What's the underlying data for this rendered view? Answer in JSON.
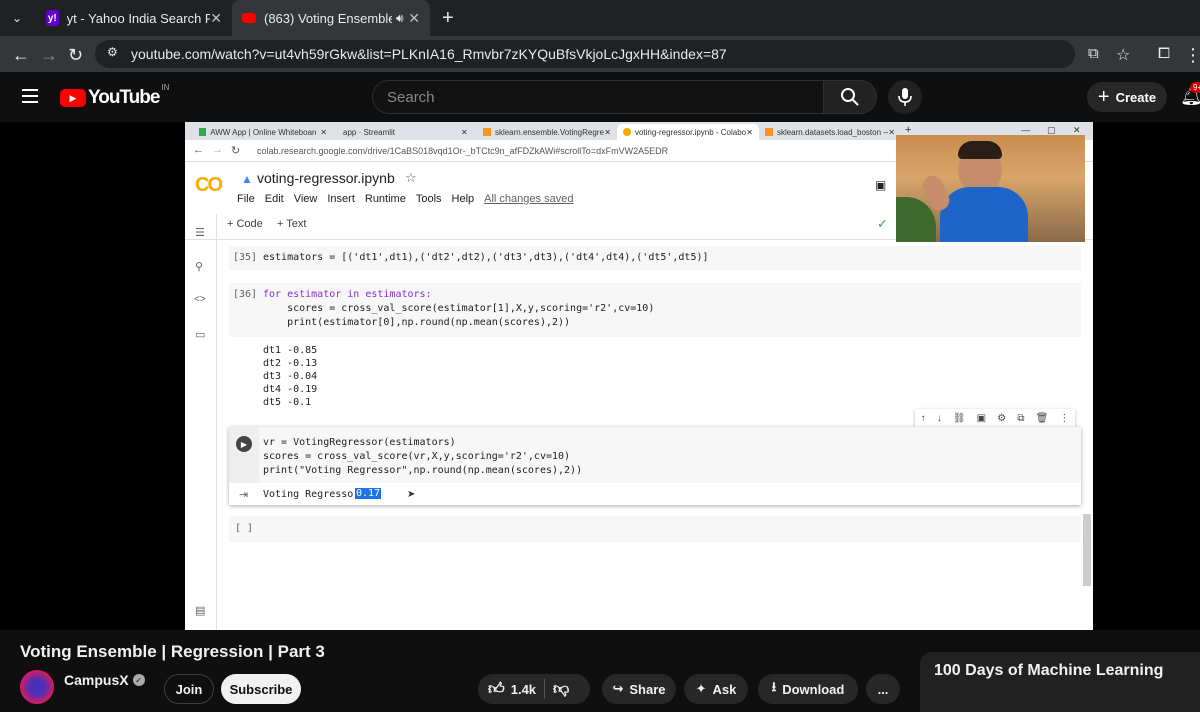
{
  "browser": {
    "tabs": [
      {
        "label": "yt - Yahoo India Search Results",
        "favicon": "y!",
        "active": false
      },
      {
        "label": "(863) Voting Ensemble | Reg",
        "favicon": "yt",
        "active": true
      }
    ],
    "new_tab": "+",
    "url": "youtube.com/watch?v=ut4vh59rGkw&list=PLKnIA16_Rmvbr7zKYQuBfsVkjoLcJgxHH&index=87"
  },
  "youtube": {
    "logo": "YouTube",
    "country": "IN",
    "search_placeholder": "Search",
    "create_label": "Create",
    "notification_count": "9+"
  },
  "inner_browser": {
    "tabs": [
      {
        "label": "AWW App | Online Whiteboard f"
      },
      {
        "label": "app · Streamlit"
      },
      {
        "label": "sklearn.ensemble.VotingRegress"
      },
      {
        "label": "voting-regressor.ipynb - Colabo"
      },
      {
        "label": "sklearn.datasets.load_boston —"
      }
    ],
    "url": "colab.research.google.com/drive/1CaBS018vqd1Or-_bTCtc9n_afFDZkAWi#scrollTo=dxFmVW2A5EDR"
  },
  "colab": {
    "logo": "CO",
    "notebook_name": "voting-regressor.ipynb",
    "menu": [
      "File",
      "Edit",
      "View",
      "Insert",
      "Runtime",
      "Tools",
      "Help"
    ],
    "saved_status": "All changes saved",
    "add_code": "+ Code",
    "add_text": "+ Text",
    "cell35_prompt": "[35]",
    "cell35_code": "estimators = [('dt1',dt1),('dt2',dt2),('dt3',dt3),('dt4',dt4),('dt5',dt5)]",
    "cell36_prompt": "[36]",
    "cell36_line1": "for estimator in estimators:",
    "cell36_line2": "    scores = cross_val_score(estimator[1],X,y,scoring='r2',cv=10)",
    "cell36_line3": "    print(estimator[0],np.round(np.mean(scores),2))",
    "cell36_output": [
      "dt1 -0.85",
      "dt2 -0.13",
      "dt3 -0.04",
      "dt4 -0.19",
      "dt5 -0.1"
    ],
    "cell_active_line1": "vr = VotingRegressor(estimators)",
    "cell_active_line2": "scores = cross_val_score(vr,X,y,scoring='r2',cv=10)",
    "cell_active_line3": "print(\"Voting Regressor\",np.round(np.mean(scores),2))",
    "cell_active_output_text": "Voting Regressor",
    "cell_active_output_value": "0.17",
    "empty_cell_prompt": "[ ]"
  },
  "video": {
    "title": "Voting Ensemble | Regression | Part 3",
    "channel": "CampusX",
    "join_label": "Join",
    "subscribe_label": "Subscribe",
    "likes": "1.4k",
    "share_label": "Share",
    "ask_label": "Ask",
    "download_label": "Download",
    "more_label": "..."
  },
  "playlist": {
    "title": "100 Days of Machine Learning"
  },
  "colors": {
    "youtube_red": "#ff0000",
    "colab_orange": "#f9ab00",
    "highlight": "#1a73e8"
  }
}
